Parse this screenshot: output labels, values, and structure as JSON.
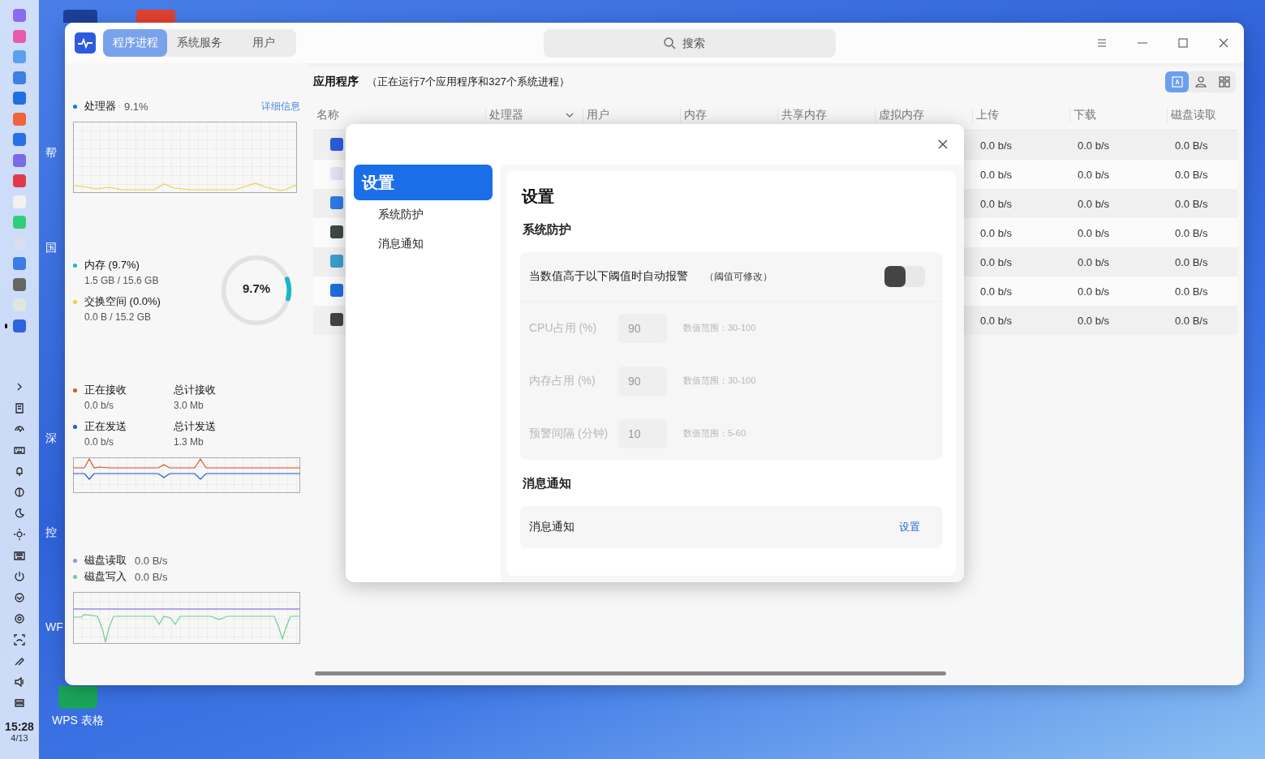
{
  "desktop": {
    "icons": [
      {
        "label": "帮"
      },
      {
        "label": "国"
      },
      {
        "label": "深"
      },
      {
        "label": "控"
      },
      {
        "label": "WF"
      },
      {
        "label": "WPS 表格"
      }
    ]
  },
  "dock": {
    "apps": [
      {
        "running": false
      },
      {
        "running": false
      },
      {
        "running": false
      },
      {
        "running": false
      },
      {
        "running": false
      },
      {
        "running": false
      },
      {
        "running": false
      },
      {
        "running": false
      },
      {
        "running": false
      },
      {
        "running": false
      },
      {
        "running": false
      },
      {
        "running": false
      },
      {
        "running": false
      },
      {
        "running": false
      },
      {
        "running": false
      },
      {
        "running": true
      }
    ],
    "time": "15:28",
    "date": "4/13"
  },
  "window": {
    "tabs": [
      {
        "label": "程序进程",
        "selected": true
      },
      {
        "label": "系统服务",
        "selected": false
      },
      {
        "label": "用户",
        "selected": false
      }
    ],
    "search": {
      "placeholder": "搜索"
    },
    "sidebar": {
      "cpu": {
        "label": "处理器",
        "value": "9.1%",
        "color": "#1a73e8",
        "link": "详细信息"
      },
      "memory": [
        {
          "label": "内存 (9.7%)",
          "detail": "1.5 GB / 15.6 GB",
          "color": "#19b6c4"
        },
        {
          "label": "交换空间 (0.0%)",
          "detail": "0.0 B / 15.2 GB",
          "color": "#f2d13c"
        }
      ],
      "memory_ring": {
        "text": "9.7%",
        "level": 0.097
      },
      "network": [
        {
          "label": "正在接收",
          "value": "0.0 b/s",
          "color": "#d9531e",
          "total_label": "总计接收",
          "total": "3.0 Mb"
        },
        {
          "label": "正在发送",
          "value": "0.0 b/s",
          "color": "#1d5cc8",
          "total_label": "总计发送",
          "total": "1.3 Mb"
        }
      ],
      "disk": [
        {
          "label": "磁盘读取",
          "value": "0.0 B/s",
          "color": "#9b8ee8"
        },
        {
          "label": "磁盘写入",
          "value": "0.0 B/s",
          "color": "#6fcf8a"
        }
      ]
    },
    "processes": {
      "title": "应用程序",
      "subtitle": "（正在运行7个应用程序和327个系统进程）",
      "view_buttons": [
        {
          "selected": true
        },
        {
          "selected": false
        },
        {
          "selected": false
        }
      ],
      "columns": [
        {
          "label": "名称",
          "sorted": false
        },
        {
          "label": "处理器",
          "sorted": true
        },
        {
          "label": "用户",
          "sorted": false
        },
        {
          "label": "内存",
          "sorted": false
        },
        {
          "label": "共享内存",
          "sorted": false
        },
        {
          "label": "虚拟内存",
          "sorted": false
        },
        {
          "label": "上传",
          "sorted": false
        },
        {
          "label": "下载",
          "sorted": false
        },
        {
          "label": "磁盘读取",
          "sorted": false
        }
      ],
      "rows": [
        {
          "upload": "0.0 b/s",
          "download": "0.0 b/s",
          "disk_read": "0.0 B/s"
        },
        {
          "upload": "0.0 b/s",
          "download": "0.0 b/s",
          "disk_read": "0.0 B/s"
        },
        {
          "upload": "0.0 b/s",
          "download": "0.0 b/s",
          "disk_read": "0.0 B/s"
        },
        {
          "upload": "0.0 b/s",
          "download": "0.0 b/s",
          "disk_read": "0.0 B/s"
        },
        {
          "upload": "0.0 b/s",
          "download": "0.0 b/s",
          "disk_read": "0.0 B/s"
        },
        {
          "upload": "0.0 b/s",
          "download": "0.0 b/s",
          "disk_read": "0.0 B/s"
        },
        {
          "upload": "0.0 b/s",
          "download": "0.0 b/s",
          "disk_read": "0.0 B/s"
        }
      ]
    },
    "settings_dialog": {
      "nav": [
        {
          "label": "设置",
          "kind": "group",
          "selected": true
        },
        {
          "label": "系统防护",
          "kind": "item",
          "selected": false
        },
        {
          "label": "消息通知",
          "kind": "item",
          "selected": false
        }
      ],
      "title": "设置",
      "protection": {
        "heading": "系统防护",
        "toggle_label": "当数值高于以下阈值时自动报警",
        "toggle_note": "（阈值可修改）",
        "on": false,
        "fields": [
          {
            "label": "CPU占用 (%)",
            "value": "90",
            "range": "数值范围：30-100",
            "disabled": true
          },
          {
            "label": "内存占用 (%)",
            "value": "90",
            "range": "数值范围：30-100",
            "disabled": true
          },
          {
            "label": "预警间隔 (分钟)",
            "value": "10",
            "range": "数值范围：5-60",
            "disabled": true
          }
        ]
      },
      "notify": {
        "heading": "消息通知",
        "label": "消息通知",
        "link": "设置"
      }
    }
  }
}
